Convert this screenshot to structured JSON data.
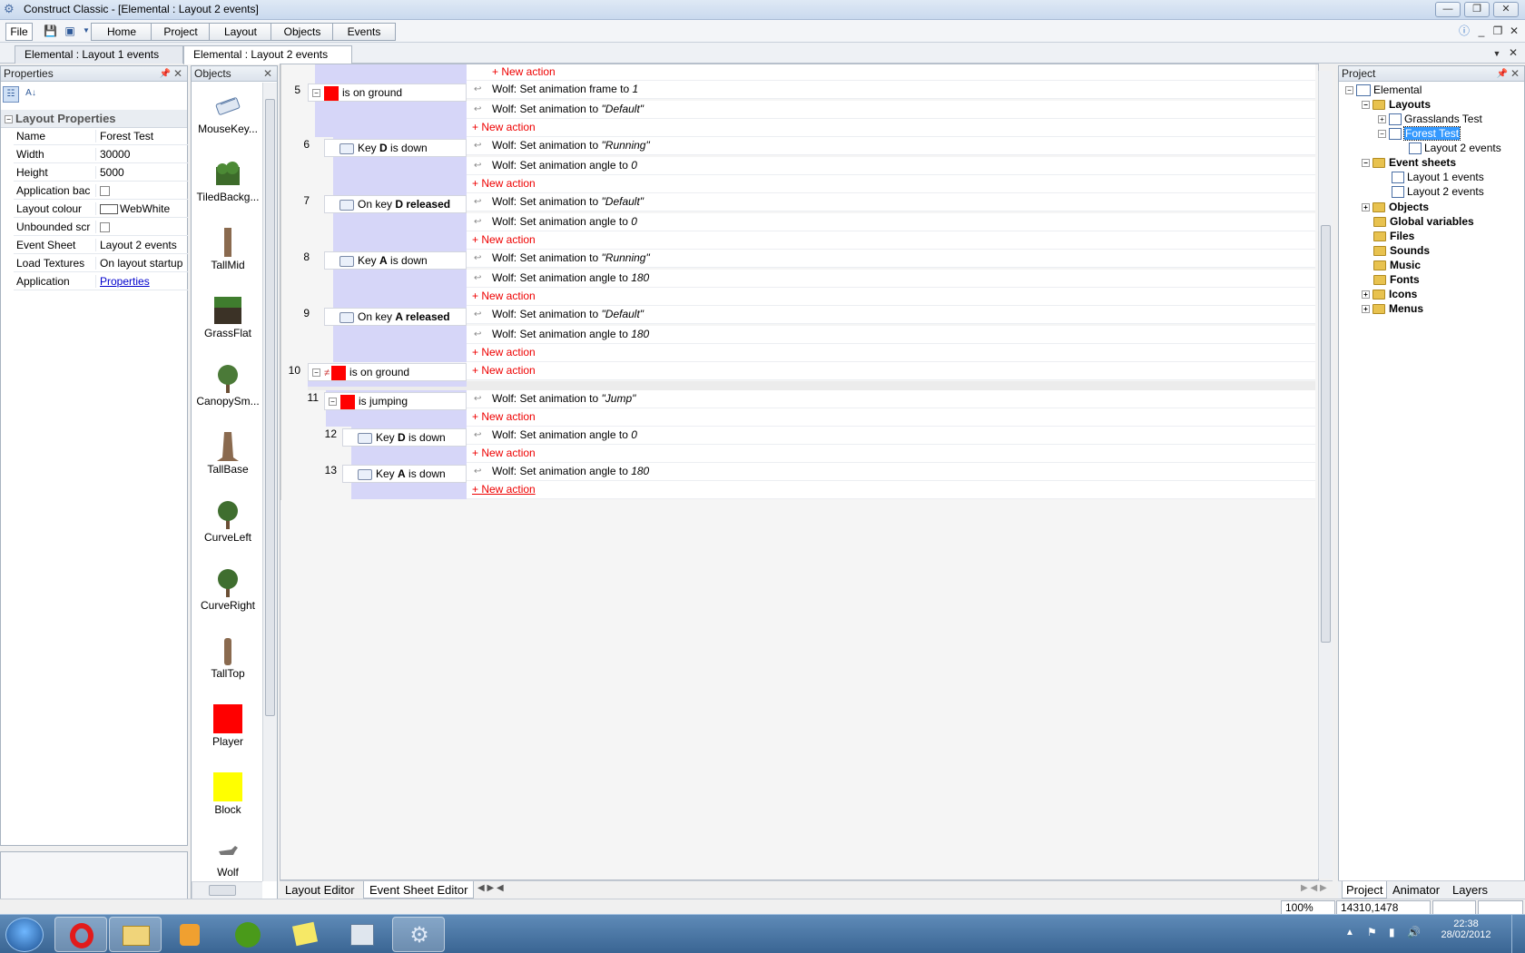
{
  "window": {
    "title": "Construct Classic - [Elemental : Layout 2 events]"
  },
  "ribbon": {
    "file_label": "File",
    "tabs": [
      "Home",
      "Project",
      "Layout",
      "Objects",
      "Events"
    ]
  },
  "doc_tabs": [
    "Elemental : Layout 1 events",
    "Elemental : Layout 2 events"
  ],
  "properties": {
    "title": "Properties",
    "section": "Layout Properties",
    "rows": [
      {
        "key": "Name",
        "value": "Forest Test"
      },
      {
        "key": "Width",
        "value": "30000"
      },
      {
        "key": "Height",
        "value": "5000"
      },
      {
        "key": "Application bac",
        "value": ""
      },
      {
        "key": "Layout colour",
        "value": "WebWhite"
      },
      {
        "key": "Unbounded scr",
        "value": ""
      },
      {
        "key": "Event Sheet",
        "value": "Layout 2 events"
      },
      {
        "key": "Load Textures",
        "value": "On layout startup"
      },
      {
        "key": "Application",
        "value": "Properties"
      }
    ]
  },
  "objects": {
    "title": "Objects",
    "items": [
      "MouseKey...",
      "TiledBackg...",
      "TallMid",
      "GrassFlat",
      "CanopySm...",
      "TallBase",
      "CurveLeft",
      "CurveRight",
      "TallTop",
      "Player",
      "Block",
      "Wolf"
    ]
  },
  "events": {
    "top_new_action": "+ New action",
    "e5": {
      "num": "5",
      "cond": "is on ground",
      "a1": "Wolf: Set animation frame to ",
      "a1v": "1",
      "a2": "Wolf: Set animation to ",
      "a2v": "\"Default\"",
      "new": "+ New action"
    },
    "e6": {
      "num": "6",
      "cond_pre": "Key ",
      "cond_key": "D",
      "cond_post": " is down",
      "a1": "Wolf: Set animation to ",
      "a1v": "\"Running\"",
      "a2": "Wolf: Set animation angle to ",
      "a2v": "0",
      "new": "+ New action"
    },
    "e7": {
      "num": "7",
      "cond_pre": "On key ",
      "cond_key": "D",
      "cond_post": " released",
      "a1": "Wolf: Set animation to ",
      "a1v": "\"Default\"",
      "a2": "Wolf: Set animation angle to ",
      "a2v": "0",
      "new": "+ New action"
    },
    "e8": {
      "num": "8",
      "cond_pre": "Key ",
      "cond_key": "A",
      "cond_post": " is down",
      "a1": "Wolf: Set animation to ",
      "a1v": "\"Running\"",
      "a2": "Wolf: Set animation angle to ",
      "a2v": "180",
      "new": "+ New action"
    },
    "e9": {
      "num": "9",
      "cond_pre": "On key ",
      "cond_key": "A",
      "cond_post": " released",
      "a1": "Wolf: Set animation to ",
      "a1v": "\"Default\"",
      "a2": "Wolf: Set animation angle to ",
      "a2v": "180",
      "new": "+ New action"
    },
    "e10": {
      "num": "10",
      "cond": "is on ground",
      "new": "+ New action"
    },
    "e11": {
      "num": "11",
      "cond": "is jumping",
      "a1": "Wolf: Set animation to ",
      "a1v": "\"Jump\"",
      "new": "+ New action"
    },
    "e12": {
      "num": "12",
      "cond_pre": "Key ",
      "cond_key": "D",
      "cond_post": " is down",
      "a1": "Wolf: Set animation angle to ",
      "a1v": "0",
      "new": "+ New action"
    },
    "e13": {
      "num": "13",
      "cond_pre": "Key ",
      "cond_key": "A",
      "cond_post": " is down",
      "a1": "Wolf: Set animation angle to ",
      "a1v": "180",
      "new": "+ New action"
    }
  },
  "bottom_tabs": [
    "Layout Editor",
    "Event Sheet Editor"
  ],
  "project": {
    "title": "Project",
    "root": "Elemental",
    "layouts": "Layouts",
    "layout_items": [
      "Grasslands Test",
      "Forest Test"
    ],
    "layout_child": "Layout 2 events",
    "event_sheets": "Event sheets",
    "event_sheet_items": [
      "Layout 1 events",
      "Layout 2 events"
    ],
    "folders": [
      "Objects",
      "Global variables",
      "Files",
      "Sounds",
      "Music",
      "Fonts",
      "Icons",
      "Menus"
    ],
    "tabs": [
      "Project",
      "Animator",
      "Layers"
    ]
  },
  "status": {
    "zoom": "100%",
    "coords": "14310,1478"
  },
  "taskbar": {
    "time": "22:38",
    "date": "28/02/2012"
  }
}
